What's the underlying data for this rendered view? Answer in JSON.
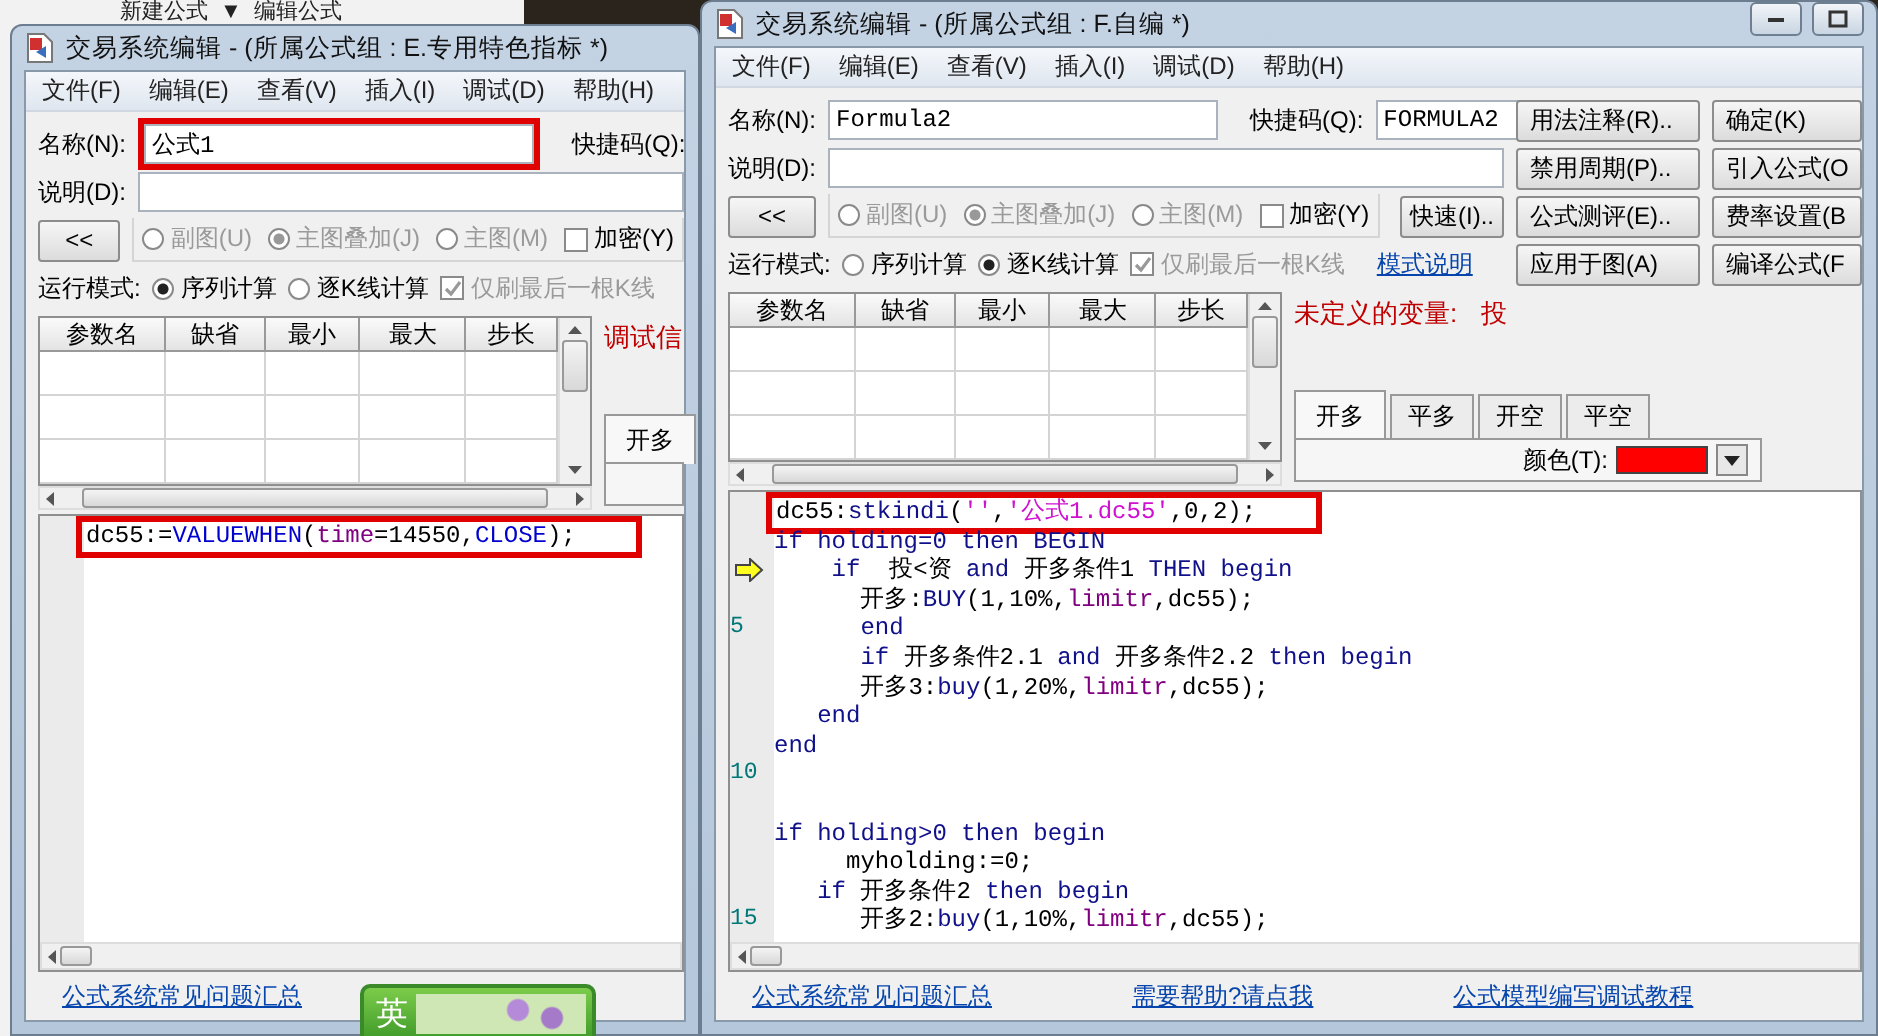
{
  "background_app": {
    "texts": [
      "新建公式",
      "▼",
      "编辑公式"
    ]
  },
  "windows": [
    {
      "title": "交易系统编辑 - (所属公式组 : E.专用特色指标 *)",
      "menu": [
        "文件(F)",
        "编辑(E)",
        "查看(V)",
        "插入(I)",
        "调试(D)",
        "帮助(H)"
      ],
      "name": {
        "label": "名称(N):",
        "value": "公式1",
        "highlighted": true
      },
      "shortcut": {
        "label": "快捷码(Q):"
      },
      "description": {
        "label": "说明(D):"
      },
      "collapse_button": "<<",
      "chart_options": [
        {
          "label": "副图(U)",
          "selected": false,
          "disabled": true
        },
        {
          "label": "主图叠加(J)",
          "selected": true,
          "disabled": true
        },
        {
          "label": "主图(M)",
          "selected": false,
          "disabled": true
        }
      ],
      "encrypt": {
        "label": "加密(Y)",
        "checked": false
      },
      "run_mode": {
        "label": "运行模式:",
        "options": [
          {
            "label": "序列计算",
            "selected": true
          },
          {
            "label": "逐K线计算",
            "selected": false
          }
        ]
      },
      "last_bar_only": {
        "label": "仅刷最后一根K线",
        "checked": true,
        "disabled": true
      },
      "params": {
        "columns": [
          "参数名",
          "缺省",
          "最小",
          "最大",
          "步长"
        ]
      },
      "messages": [
        "调试信"
      ],
      "signal_tabs": [
        {
          "label": "开多",
          "selected": true
        }
      ],
      "code": [
        {
          "current": false,
          "highlighted": true,
          "tokens": [
            {
              "kind": "plain",
              "text": "dc55:="
            },
            {
              "kind": "function",
              "text": "VALUEWHEN"
            },
            {
              "kind": "plain",
              "text": "("
            },
            {
              "kind": "variable",
              "text": "time"
            },
            {
              "kind": "plain",
              "text": "=14550,"
            },
            {
              "kind": "function",
              "text": "CLOSE"
            },
            {
              "kind": "plain",
              "text": ");"
            }
          ]
        }
      ],
      "footer_links": [
        "公式系统常见问题汇总"
      ]
    },
    {
      "title": "交易系统编辑 - (所属公式组 : F.自编 *)",
      "window_controls": [
        {
          "kind": "minimize"
        },
        {
          "kind": "maximize"
        }
      ],
      "menu": [
        "文件(F)",
        "编辑(E)",
        "查看(V)",
        "插入(I)",
        "调试(D)",
        "帮助(H)"
      ],
      "name": {
        "label": "名称(N):",
        "value": "Formula2",
        "highlighted": false
      },
      "shortcut": {
        "label": "快捷码(Q):",
        "value": "FORMULA2"
      },
      "description": {
        "label": "说明(D):"
      },
      "collapse_button": "<<",
      "chart_options": [
        {
          "label": "副图(U)",
          "selected": false,
          "disabled": true
        },
        {
          "label": "主图叠加(J)",
          "selected": true,
          "disabled": true
        },
        {
          "label": "主图(M)",
          "selected": false,
          "disabled": true
        }
      ],
      "encrypt": {
        "label": "加密(Y)",
        "checked": false
      },
      "quick_button": "快速(I)..",
      "run_mode": {
        "label": "运行模式:",
        "options": [
          {
            "label": "序列计算",
            "selected": false
          },
          {
            "label": "逐K线计算",
            "selected": true
          }
        ]
      },
      "last_bar_only": {
        "label": "仅刷最后一根K线",
        "checked": true,
        "disabled": true
      },
      "mode_link": "模式说明",
      "side_buttons": [
        "用法注释(R)..",
        "确定(K)",
        "禁用周期(P)..",
        "引入公式(O",
        "公式测评(E)..",
        "费率设置(B",
        "应用于图(A)",
        "编译公式(F"
      ],
      "params": {
        "columns": [
          "参数名",
          "缺省",
          "最小",
          "最大",
          "步长"
        ]
      },
      "messages": [
        "未定义的变量:",
        "投"
      ],
      "signal_tabs": [
        {
          "label": "开多",
          "selected": true
        },
        {
          "label": "平多",
          "selected": false
        },
        {
          "label": "开空",
          "selected": false
        },
        {
          "label": "平空",
          "selected": false
        }
      ],
      "color": {
        "label": "颜色(T):",
        "color": "#ff0000"
      },
      "code": [
        {
          "current": false,
          "highlighted": true,
          "tokens": [
            {
              "kind": "plain",
              "text": "dc55:"
            },
            {
              "kind": "keyword",
              "text": "stkindi"
            },
            {
              "kind": "plain",
              "text": "("
            },
            {
              "kind": "string",
              "text": "''"
            },
            {
              "kind": "plain",
              "text": ","
            },
            {
              "kind": "string",
              "text": "'公式1.dc55'"
            },
            {
              "kind": "plain",
              "text": ",0,2);"
            }
          ]
        },
        {
          "current": false,
          "highlighted": false,
          "tokens": [
            {
              "kind": "keyword",
              "text": "if holding=0 then BEGIN"
            }
          ]
        },
        {
          "current": true,
          "highlighted": false,
          "tokens": [
            {
              "kind": "keyword",
              "text": "    if"
            },
            {
              "kind": "plain",
              "text": "  投<资 "
            },
            {
              "kind": "keyword",
              "text": "and"
            },
            {
              "kind": "plain",
              "text": " 开多条件1 "
            },
            {
              "kind": "keyword",
              "text": "THEN begin"
            }
          ]
        },
        {
          "current": false,
          "highlighted": false,
          "tokens": [
            {
              "kind": "plain",
              "text": "      开多:"
            },
            {
              "kind": "keyword",
              "text": "BUY"
            },
            {
              "kind": "plain",
              "text": "(1,10%,"
            },
            {
              "kind": "variable",
              "text": "limitr"
            },
            {
              "kind": "plain",
              "text": ",dc55);"
            }
          ]
        },
        {
          "number": "5",
          "current": false,
          "highlighted": false,
          "tokens": [
            {
              "kind": "keyword",
              "text": "      end"
            }
          ]
        },
        {
          "current": false,
          "highlighted": false,
          "tokens": [
            {
              "kind": "keyword",
              "text": "      if"
            },
            {
              "kind": "plain",
              "text": " 开多条件2.1 "
            },
            {
              "kind": "keyword",
              "text": "and"
            },
            {
              "kind": "plain",
              "text": " 开多条件2.2 "
            },
            {
              "kind": "keyword",
              "text": "then begin"
            }
          ]
        },
        {
          "current": false,
          "highlighted": false,
          "tokens": [
            {
              "kind": "plain",
              "text": "      开多3:"
            },
            {
              "kind": "keyword",
              "text": "buy"
            },
            {
              "kind": "plain",
              "text": "(1,20%,"
            },
            {
              "kind": "variable",
              "text": "limitr"
            },
            {
              "kind": "plain",
              "text": ",dc55);"
            }
          ]
        },
        {
          "current": false,
          "highlighted": false,
          "tokens": [
            {
              "kind": "keyword",
              "text": "   end"
            }
          ]
        },
        {
          "current": false,
          "highlighted": false,
          "tokens": [
            {
              "kind": "keyword",
              "text": "end"
            }
          ]
        },
        {
          "number": "10",
          "current": false,
          "highlighted": false
        },
        {
          "current": false,
          "highlighted": false
        },
        {
          "current": false,
          "highlighted": false,
          "tokens": [
            {
              "kind": "keyword",
              "text": "if holding>0 then begin"
            }
          ]
        },
        {
          "current": false,
          "highlighted": false,
          "tokens": [
            {
              "kind": "plain",
              "text": "     myholding:=0;"
            }
          ]
        },
        {
          "current": false,
          "highlighted": false,
          "tokens": [
            {
              "kind": "keyword",
              "text": "   if"
            },
            {
              "kind": "plain",
              "text": " 开多条件2 "
            },
            {
              "kind": "keyword",
              "text": "then begin"
            }
          ]
        },
        {
          "number": "15",
          "current": false,
          "highlighted": false,
          "tokens": [
            {
              "kind": "plain",
              "text": "      开多2:"
            },
            {
              "kind": "keyword",
              "text": "buy"
            },
            {
              "kind": "plain",
              "text": "(1,10%,"
            },
            {
              "kind": "variable",
              "text": "limitr"
            },
            {
              "kind": "plain",
              "text": ",dc55);"
            }
          ]
        }
      ],
      "footer_links": [
        "公式系统常见问题汇总",
        "需要帮助?请点我",
        "公式模型编写调试教程"
      ]
    }
  ],
  "ime_badge": {
    "label": "英"
  }
}
